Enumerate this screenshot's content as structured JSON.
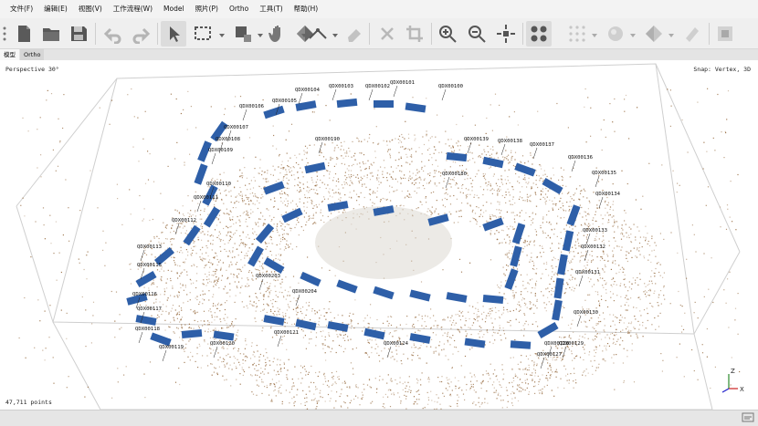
{
  "menu": [
    "文件(F)",
    "编辑(E)",
    "视图(V)",
    "工作流程(W)",
    "Model",
    "照片(P)",
    "Ortho",
    "工具(T)",
    "帮助(H)"
  ],
  "tabs": [
    "模型",
    "Ortho"
  ],
  "viewport": {
    "projection": "Perspective 30°",
    "snap": "Snap: Vertex, 3D",
    "points": "47,711 points",
    "axis_labels": [
      "Z",
      "X"
    ]
  },
  "camera_labels": [
    "QDX00100",
    "QDX00101",
    "QDX00102",
    "QDX00103",
    "QDX00104",
    "QDX00105",
    "QDX00106",
    "QDX00107",
    "QDX00108",
    "QDX00109",
    "QDX00110",
    "QDX00111",
    "QDX00112",
    "QDX00113",
    "QDX00115",
    "QDX00116",
    "QDX00117",
    "QDX00118",
    "QDX00119",
    "QDX00120",
    "QDX00121",
    "QDX00124",
    "QDX00127",
    "QDX00128",
    "QDX00129",
    "QDX00130",
    "QDX00131",
    "QDX00132",
    "QDX00133",
    "QDX00134",
    "QDX00135",
    "QDX00136",
    "QDX00137",
    "QDX00138",
    "QDX00139",
    "QDX00180",
    "QDX00190",
    "QDX00204",
    "QDX00203"
  ],
  "colors": {
    "camera": "#2e5fa8",
    "points": "#9a7046",
    "box": "#cfcfcf"
  }
}
